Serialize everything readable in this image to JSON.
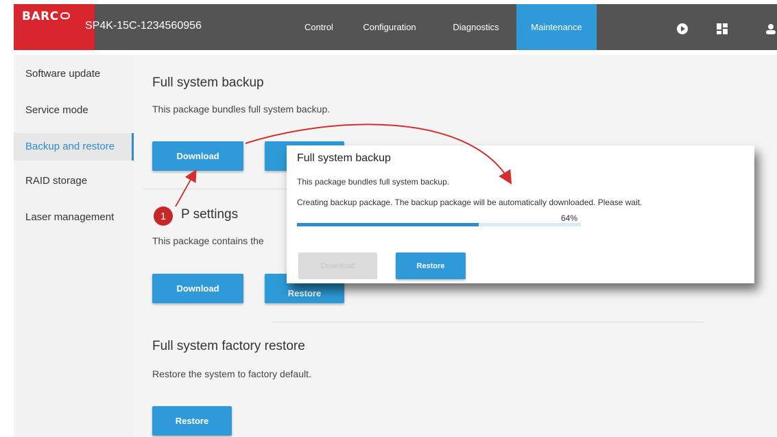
{
  "header": {
    "logo": "BARC",
    "device_name": "SP4K-15C-1234560956",
    "tabs": [
      {
        "label": "Control"
      },
      {
        "label": "Configuration"
      },
      {
        "label": "Diagnostics"
      },
      {
        "label": "Maintenance",
        "active": true
      }
    ],
    "icons": [
      "play-icon",
      "layout-icon",
      "user-icon"
    ]
  },
  "sidebar": {
    "items": [
      {
        "label": "Software update"
      },
      {
        "label": "Service mode"
      },
      {
        "label": "Backup and restore",
        "active": true
      },
      {
        "label": "RAID storage"
      },
      {
        "label": "Laser management"
      }
    ]
  },
  "main": {
    "backup": {
      "title": "Full system backup",
      "desc": "This package bundles full system backup.",
      "download_label": "Download"
    },
    "settings": {
      "title": "P settings",
      "desc": "This package contains the",
      "download_label": "Download",
      "restore_label": "Restore"
    },
    "factory": {
      "title": "Full system factory restore",
      "desc": "Restore the system to factory default.",
      "restore_label": "Restore"
    }
  },
  "dialog": {
    "title": "Full system backup",
    "line1": "This package bundles full system backup.",
    "line2": "Creating backup package. The backup package will be automatically downloaded. Please wait.",
    "progress_percent": 64,
    "progress_label": "64%",
    "download_label": "Download",
    "restore_label": "Restore"
  },
  "callout": {
    "number": "1"
  },
  "colors": {
    "accent": "#2e9ad7",
    "brand": "#d8262e",
    "annotation": "#c62828"
  }
}
